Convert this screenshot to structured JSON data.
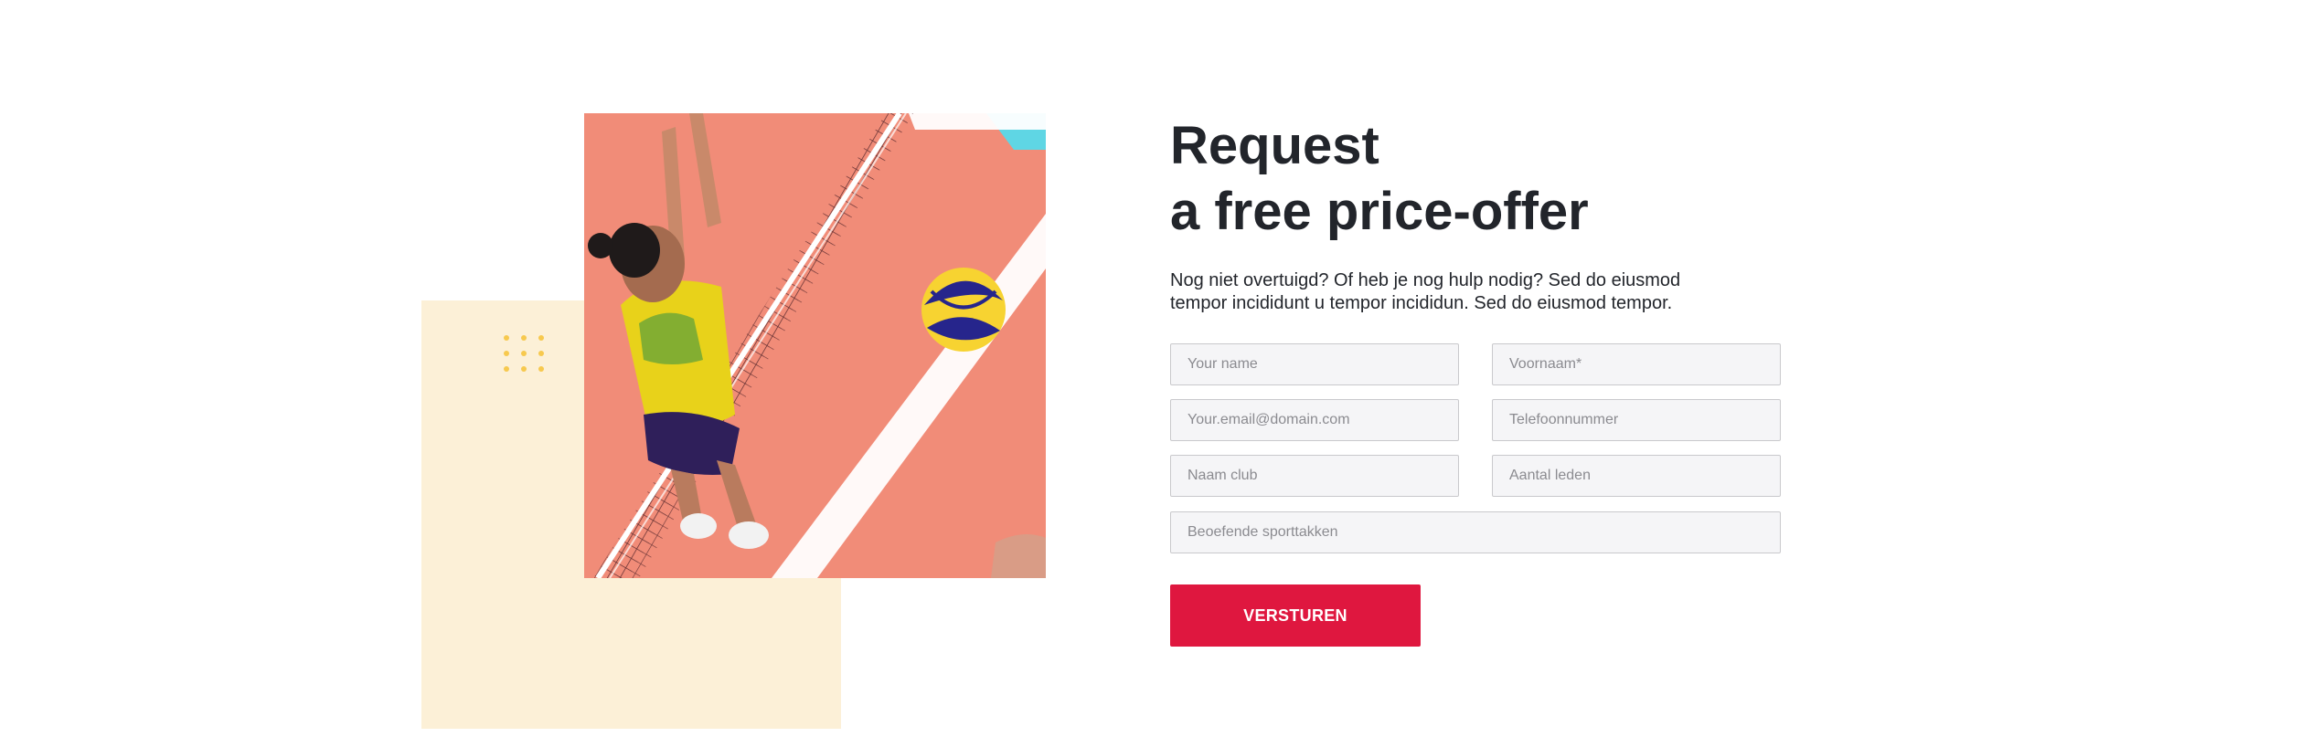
{
  "heading": {
    "line1": "Request",
    "line2": "a free price-offer"
  },
  "intro": "Nog niet overtuigd? Of heb je nog hulp nodig? Sed do eiusmod tempor incididunt u tempor incididun. Sed do eiusmod tempor.",
  "form": {
    "name_placeholder": "Your name",
    "firstname_placeholder": "Voornaam*",
    "email_placeholder": "Your.email@domain.com",
    "phone_placeholder": "Telefoonnummer",
    "club_placeholder": "Naam club",
    "members_placeholder": "Aantal leden",
    "sports_placeholder": "Beoefende sporttakken",
    "submit_label": "VERSTUREN"
  },
  "image": {
    "subject": "volleyball-player-at-net-photo"
  },
  "colors": {
    "accent": "#df173f",
    "decor_block": "#fcf0d7",
    "decor_dots": "#f7c94e",
    "heading_text": "#22252b",
    "input_background": "#f5f5f7",
    "input_border": "#c9c9cc"
  }
}
